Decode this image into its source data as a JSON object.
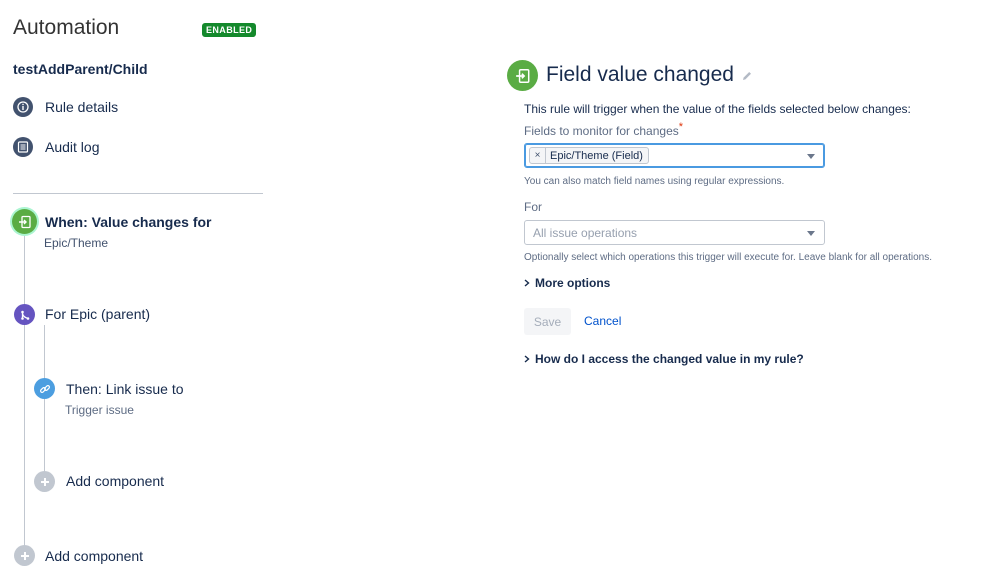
{
  "header": {
    "title": "Automation",
    "status_badge": "ENABLED"
  },
  "rule": {
    "name": "testAddParent/Child"
  },
  "sidebar": {
    "links": [
      {
        "label": "Rule details",
        "icon": "info-icon"
      },
      {
        "label": "Audit log",
        "icon": "list-icon"
      }
    ]
  },
  "flow": {
    "trigger": {
      "title": "When: Value changes for",
      "subtitle": "Epic/Theme",
      "icon": "trigger-icon",
      "color": "#5aac44"
    },
    "branch": {
      "title": "For Epic (parent)",
      "icon": "branch-icon",
      "color": "#6554c0"
    },
    "action": {
      "title": "Then: Link issue to",
      "subtitle": "Trigger issue",
      "icon": "link-icon",
      "color": "#4c9ee0"
    },
    "add_inner": {
      "label": "Add component",
      "icon": "plus-icon"
    },
    "add_outer": {
      "label": "Add component",
      "icon": "plus-icon"
    }
  },
  "panel": {
    "title": "Field value changed",
    "description": "This rule will trigger when the value of the fields selected below changes:",
    "fields_label": "Fields to monitor for changes",
    "required_mark": "*",
    "selected_field": "Epic/Theme (Field)",
    "chip_remove": "×",
    "fields_help": "You can also match field names using regular expressions.",
    "for_label": "For",
    "for_placeholder": "All issue operations",
    "for_help": "Optionally select which operations this trigger will execute for. Leave blank for all operations.",
    "more_options": "More options",
    "save": "Save",
    "cancel": "Cancel",
    "faq": "How do I access the changed value in my rule?"
  }
}
